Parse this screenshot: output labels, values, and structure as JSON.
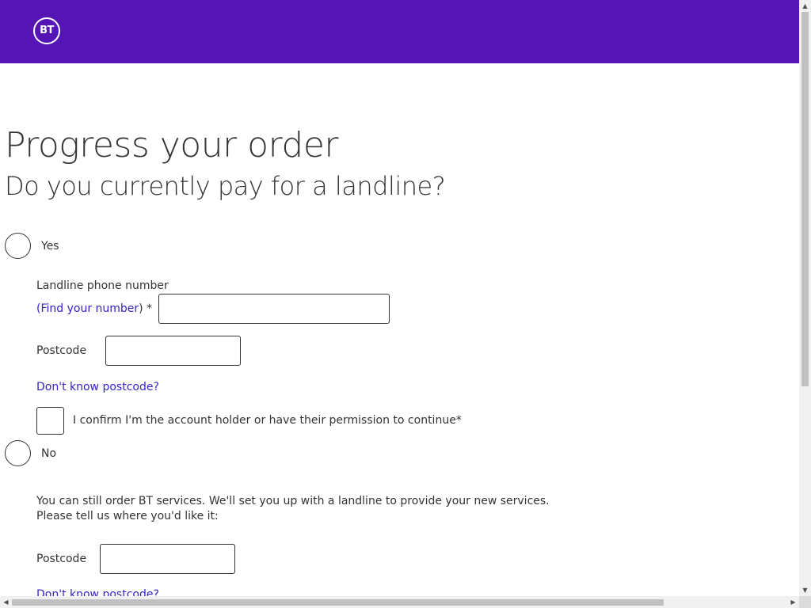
{
  "header": {
    "logo_text": "BT",
    "background": "#5514b4"
  },
  "page": {
    "title": "Progress your order",
    "question": "Do you currently pay for a landline?"
  },
  "option_yes": {
    "label": "Yes",
    "landline_label": "Landline phone number",
    "find_number_prefix": "(",
    "find_number_link": "Find your number",
    "find_number_suffix": ") *",
    "landline_value": "",
    "postcode_label": "Postcode",
    "postcode_value": "",
    "dont_know_postcode": "Don't know postcode?",
    "confirm_label": "I confirm I'm the account holder or have their permission to continue*"
  },
  "option_no": {
    "label": "No",
    "paragraph": "You can still order BT services. We'll set you up with a landline to provide your new services. Please tell us where you'd like it:",
    "postcode_label": "Postcode",
    "postcode_value": "",
    "dont_know_postcode": "Don't know postcode?"
  },
  "colors": {
    "brand": "#5514b4",
    "link": "#3323c9",
    "text": "#333333"
  },
  "scrollbars": {
    "up_arrow": "▲",
    "down_arrow": "▼",
    "left_arrow": "◀",
    "right_arrow": "▶"
  }
}
